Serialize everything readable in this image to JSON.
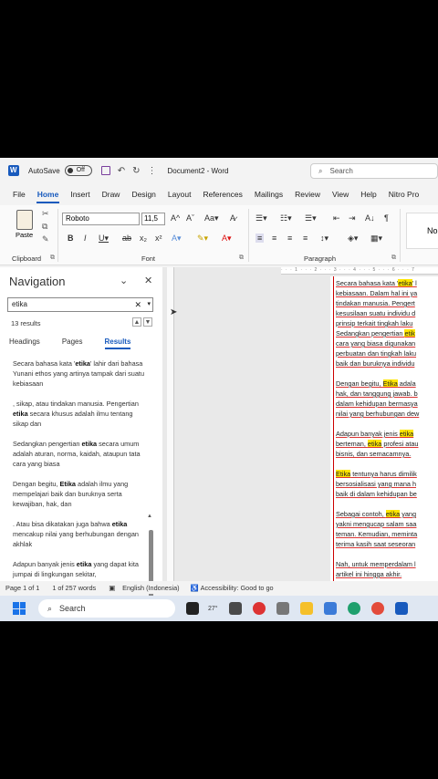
{
  "titlebar": {
    "autosave_label": "AutoSave",
    "autosave_state": "Off",
    "doc_title": "Document2 - Word",
    "search_placeholder": "Search"
  },
  "menu": {
    "tabs": [
      "File",
      "Home",
      "Insert",
      "Draw",
      "Design",
      "Layout",
      "References",
      "Mailings",
      "Review",
      "View",
      "Help",
      "Nitro Pro"
    ],
    "active": "Home"
  },
  "ribbon": {
    "paste_label": "Paste",
    "clipboard_label": "Clipboard",
    "font_name": "Roboto",
    "font_size": "11,5",
    "font_label": "Font",
    "paragraph_label": "Paragraph",
    "style_preview": "No"
  },
  "nav": {
    "title": "Navigation",
    "search_value": "etika",
    "results_count": "13 results",
    "tabs": [
      "Headings",
      "Pages",
      "Results"
    ],
    "active_tab": "Results",
    "results": [
      {
        "pre": "Secara bahasa kata '",
        "hit": "etika",
        "post": "' lahir dari bahasa Yunani ethos yang artinya tampak dari suatu kebiasaan"
      },
      {
        "pre": ", sikap, atau tindakan manusia. Pengertian ",
        "hit": "etika",
        "post": " secara khusus adalah ilmu tentang sikap dan"
      },
      {
        "pre": "Sedangkan pengertian ",
        "hit": "etika",
        "post": " secara umum adalah aturan, norma, kaidah, ataupun tata cara yang biasa"
      },
      {
        "pre": "Dengan begitu, ",
        "hit": "Etika",
        "post": " adalah ilmu yang mempelajari baik dan buruknya serta kewajiban, hak, dan"
      },
      {
        "pre": ". Atau bisa dikatakan juga bahwa ",
        "hit": "etika",
        "post": " mencakup nilai yang berhubungan dengan akhlak"
      },
      {
        "pre": "Adapun banyak jenis ",
        "hit": "etika",
        "post": " yang dapat kita jumpai di lingkungan sekitar,"
      }
    ]
  },
  "document": {
    "paragraphs": [
      {
        "segments": [
          {
            "t": "Secara bahasa kata '"
          },
          {
            "t": "etika",
            "hl": true
          },
          {
            "t": "' l\nkebiasaan. Dalam hal ini ya\ntindakan manusia. Pengert\nkesusilaan suatu individu d\nprinsip terkait tingkah laku\nSedangkan pengertian "
          },
          {
            "t": "etik",
            "hl": true
          },
          {
            "t": "\ncara yang biasa digunakan\nperbuatan dan tingkah laku\nbaik dan buruknya individu"
          }
        ]
      },
      {
        "segments": [
          {
            "t": "Dengan begitu, "
          },
          {
            "t": "Etika",
            "hl": true
          },
          {
            "t": " adala\nhak, dan tanggung jawab. b\ndalam kehidupan bermasya\nnilai yang berhubungan dew"
          }
        ]
      },
      {
        "segments": [
          {
            "t": "Adapun banyak jenis "
          },
          {
            "t": "etika",
            "hl": true
          },
          {
            "t": "\nberteman, "
          },
          {
            "t": "etika",
            "hl": true
          },
          {
            "t": " profesi atau\nbisnis, dan semacamnya."
          }
        ]
      },
      {
        "segments": [
          {
            "t": "Etika",
            "hl": true
          },
          {
            "t": " tentunya harus dimilik\nbersosialisasi yang mana h\nbaik di dalam kehidupan be"
          }
        ]
      },
      {
        "segments": [
          {
            "t": "Sebagai contoh, "
          },
          {
            "t": "etika",
            "hl": true
          },
          {
            "t": " yang\nyakni mengucap salam saa\nteman. Kemudian, meminta\nterima kasih saat seseoran"
          }
        ]
      },
      {
        "segments": [
          {
            "t": "Nah, untuk memperdalam l\nartikel ini hingga akhir."
          }
        ]
      }
    ]
  },
  "statusbar": {
    "page": "Page 1 of 1",
    "words": "1 of 257 words",
    "language": "English (Indonesia)",
    "accessibility": "Accessibility: Good to go"
  },
  "taskbar": {
    "search_label": "Search",
    "weather": "27°"
  }
}
